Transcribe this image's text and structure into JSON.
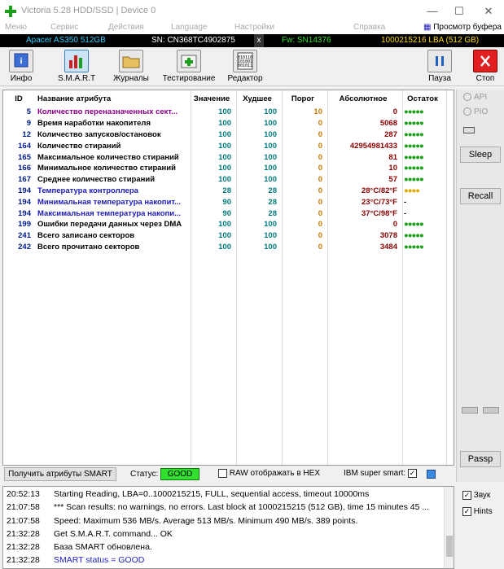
{
  "window": {
    "title": "Victoria 5.28 HDD/SSD | Device 0",
    "minimize": "—",
    "maximize": "☐",
    "close": "✕"
  },
  "menu": {
    "items": [
      "Меню",
      "Сервис",
      "Действия",
      "Language",
      "Настройки",
      "Справка"
    ],
    "buffer_view": "Просмотр буфера"
  },
  "drive": {
    "model": "Apacer AS350 512GB",
    "serial": "SN: CN368TC4902875",
    "eject": "x",
    "firmware": "Fw: SN14376",
    "lba": "1000215216 LBA (512 GB)"
  },
  "toolbar": {
    "info": "Инфо",
    "smart": "S.M.A.R.T",
    "journals": "Журналы",
    "testing": "Тестирование",
    "editor": "Редактор",
    "pause": "Пауза",
    "stop": "Стоп"
  },
  "smart_table": {
    "headers": {
      "id": "ID",
      "name": "Название атрибута",
      "value": "Значение",
      "worst": "Худшее",
      "threshold": "Порог",
      "raw": "Абсолютное",
      "remaining": "Остаток"
    },
    "rows": [
      {
        "id": "5",
        "name": "Количество переназначенных сект...",
        "value": "100",
        "worst": "100",
        "threshold": "10",
        "raw": "0",
        "remaining": "●●●●●",
        "name_color": "#8b008b",
        "remaining_color": "#1aa11a"
      },
      {
        "id": "9",
        "name": "Время наработки накопителя",
        "value": "100",
        "worst": "100",
        "threshold": "0",
        "raw": "5068",
        "remaining": "●●●●●",
        "name_color": "#000000",
        "remaining_color": "#1aa11a"
      },
      {
        "id": "12",
        "name": "Количество запусков/остановок",
        "value": "100",
        "worst": "100",
        "threshold": "0",
        "raw": "287",
        "remaining": "●●●●●",
        "name_color": "#000000",
        "remaining_color": "#1aa11a"
      },
      {
        "id": "164",
        "name": "Количество стираний",
        "value": "100",
        "worst": "100",
        "threshold": "0",
        "raw": "42954981433",
        "remaining": "●●●●●",
        "name_color": "#000000",
        "remaining_color": "#1aa11a"
      },
      {
        "id": "165",
        "name": "Максимальное количество стираний",
        "value": "100",
        "worst": "100",
        "threshold": "0",
        "raw": "81",
        "remaining": "●●●●●",
        "name_color": "#000000",
        "remaining_color": "#1aa11a"
      },
      {
        "id": "166",
        "name": "Минимальное количество стираний",
        "value": "100",
        "worst": "100",
        "threshold": "0",
        "raw": "10",
        "remaining": "●●●●●",
        "name_color": "#000000",
        "remaining_color": "#1aa11a"
      },
      {
        "id": "167",
        "name": "Среднее количество стираний",
        "value": "100",
        "worst": "100",
        "threshold": "0",
        "raw": "57",
        "remaining": "●●●●●",
        "name_color": "#000000",
        "remaining_color": "#1aa11a"
      },
      {
        "id": "194",
        "name": "Температура контроллера",
        "value": "28",
        "worst": "28",
        "threshold": "0",
        "raw": "28°C/82°F",
        "remaining": "●●●●",
        "name_color": "#1a1ab8",
        "remaining_color": "#e0a800"
      },
      {
        "id": "194",
        "name": "Минимальная температура накопит...",
        "value": "90",
        "worst": "28",
        "threshold": "0",
        "raw": "23°C/73°F",
        "remaining": "-",
        "name_color": "#1a1ab8",
        "remaining_color": "#000000"
      },
      {
        "id": "194",
        "name": "Максимальная температура накопи...",
        "value": "90",
        "worst": "28",
        "threshold": "0",
        "raw": "37°C/98°F",
        "remaining": "-",
        "name_color": "#1a1ab8",
        "remaining_color": "#000000"
      },
      {
        "id": "199",
        "name": "Ошибки передачи данных через DMA",
        "value": "100",
        "worst": "100",
        "threshold": "0",
        "raw": "0",
        "remaining": "●●●●●",
        "name_color": "#000000",
        "remaining_color": "#1aa11a"
      },
      {
        "id": "241",
        "name": "Всего записано секторов",
        "value": "100",
        "worst": "100",
        "threshold": "0",
        "raw": "3078",
        "remaining": "●●●●●",
        "name_color": "#000000",
        "remaining_color": "#1aa11a"
      },
      {
        "id": "242",
        "name": "Всего прочитано секторов",
        "value": "100",
        "worst": "100",
        "threshold": "0",
        "raw": "3484",
        "remaining": "●●●●●",
        "name_color": "#000000",
        "remaining_color": "#1aa11a"
      }
    ]
  },
  "side": {
    "api": "API",
    "pio": "PIO",
    "sleep": "Sleep",
    "recall": "Recall",
    "passp": "Passp",
    "sound": "Звук",
    "hints": "Hints"
  },
  "status": {
    "get_smart": "Получить атрибуты SMART",
    "label": "Статус:",
    "value": "GOOD",
    "raw_hex": "RAW отображать в HEX",
    "ibm": "IBM super smart:",
    "ibm_check": "✓",
    "sound_check": "✓",
    "hints_check": "✓"
  },
  "log": [
    {
      "time": "20:52:13",
      "msg": "Starting Reading, LBA=0..1000215215, FULL, sequential access, timeout 10000ms",
      "blue": false
    },
    {
      "time": "21:07:58",
      "msg": "*** Scan results: no warnings, no errors. Last block at 1000215215 (512 GB), time 15 minutes 45 ...",
      "blue": false
    },
    {
      "time": "21:07:58",
      "msg": "Speed: Maximum 536 MB/s. Average 513 MB/s. Minimum 490 MB/s. 389 points.",
      "blue": false
    },
    {
      "time": "21:32:28",
      "msg": "Get S.M.A.R.T. command... OK",
      "blue": false
    },
    {
      "time": "21:32:28",
      "msg": "База SMART обновлена.",
      "blue": false
    },
    {
      "time": "21:32:28",
      "msg": "SMART status = GOOD",
      "blue": true
    }
  ]
}
